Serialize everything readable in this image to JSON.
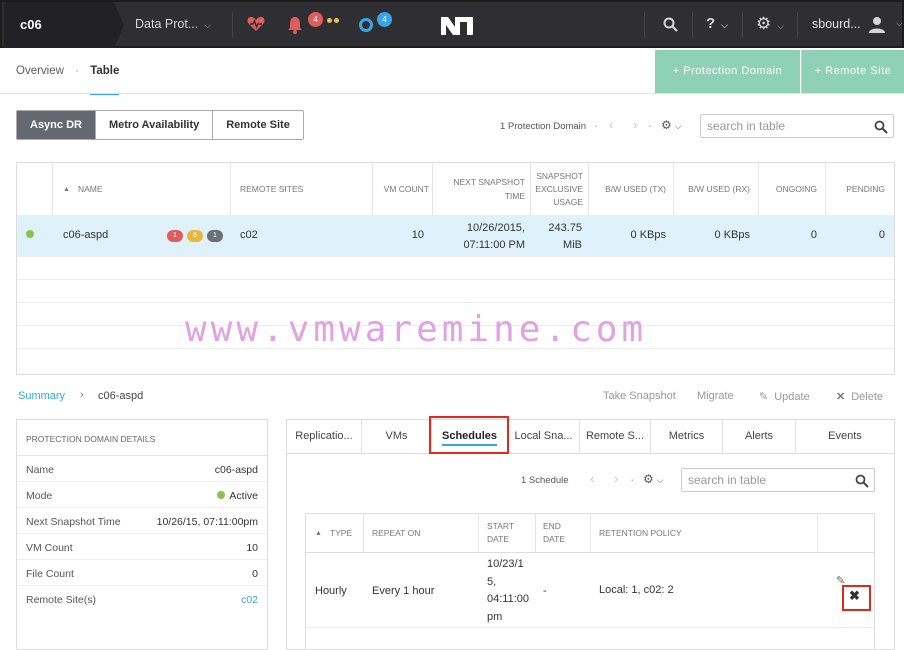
{
  "topbar": {
    "cluster_name": "c06",
    "menu_label": "Data Prot...",
    "alert_count": "4",
    "task_count": "4",
    "user_name": "sbourd..."
  },
  "subnav": {
    "tabs": [
      "Overview",
      "Table"
    ],
    "actions": [
      "+ Protection Domain",
      "+ Remote Site"
    ]
  },
  "view_toggle": [
    "Async DR",
    "Metro Availability",
    "Remote Site"
  ],
  "main_table": {
    "count_label": "1 Protection Domain",
    "search_placeholder": "search in table",
    "columns": [
      "NAME",
      "REMOTE SITES",
      "VM COUNT",
      "NEXT SNAPSHOT TIME",
      "SNAPSHOT EXCLUSIVE USAGE",
      "B/W USED (TX)",
      "B/W USED (RX)",
      "ONGOING",
      "PENDING"
    ],
    "rows": [
      {
        "name": "c06-aspd",
        "badges": [
          "1",
          "6",
          "1"
        ],
        "remote_sites": "c02",
        "vm_count": "10",
        "next_snapshot_time": [
          "10/26/2015,",
          "07:11:00 PM"
        ],
        "snapshot_exclusive_usage": [
          "243.75",
          "MiB"
        ],
        "bw_tx": "0 KBps",
        "bw_rx": "0 KBps",
        "ongoing": "0",
        "pending": "0"
      }
    ]
  },
  "watermark": "www.vmwaremine.com",
  "summary": {
    "crumb_root": "Summary",
    "crumb_separator": "›",
    "crumb_current": "c06-aspd",
    "actions": [
      "Take Snapshot",
      "Migrate",
      "Update",
      "Delete"
    ]
  },
  "details": {
    "heading": "PROTECTION DOMAIN DETAILS",
    "rows": [
      {
        "key": "Name",
        "value": "c06-aspd"
      },
      {
        "key": "Mode",
        "value": "Active"
      },
      {
        "key": "Next Snapshot Time",
        "value": "10/26/15, 07:11:00pm"
      },
      {
        "key": "VM Count",
        "value": "10"
      },
      {
        "key": "File Count",
        "value": "0"
      },
      {
        "key": "Remote Site(s)",
        "value": "c02"
      }
    ]
  },
  "tabs": [
    "Replicatio...",
    "VMs",
    "Schedules",
    "Local Sna...",
    "Remote S...",
    "Metrics",
    "Alerts",
    "Events"
  ],
  "schedule_table": {
    "count_label": "1 Schedule",
    "search_placeholder": "search in table",
    "columns": [
      "TYPE",
      "REPEAT ON",
      "START DATE",
      "END DATE",
      "RETENTION POLICY"
    ],
    "rows": [
      {
        "type": "Hourly",
        "repeat_on": "Every 1 hour",
        "start_date": [
          "10/23/1",
          "5,",
          "04:11:00",
          "pm"
        ],
        "end_date": "-",
        "retention_policy": "Local: 1, c02: 2"
      }
    ]
  },
  "colors": {
    "topbar": "#2f2f33",
    "accent": "#35a6e8",
    "green_action": "#8fd0b8",
    "selected_row": "#dff1fa",
    "highlight_box": "#e02a1f"
  }
}
